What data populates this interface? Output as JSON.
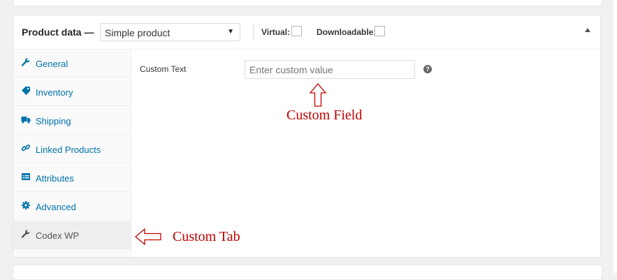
{
  "header": {
    "title": "Product data —",
    "product_type": "Simple product",
    "virtual_label": "Virtual:",
    "downloadable_label": "Downloadable:"
  },
  "sidebar": {
    "items": [
      {
        "label": "General",
        "icon": "wrench-icon"
      },
      {
        "label": "Inventory",
        "icon": "tag-icon"
      },
      {
        "label": "Shipping",
        "icon": "truck-icon"
      },
      {
        "label": "Linked Products",
        "icon": "link-icon"
      },
      {
        "label": "Attributes",
        "icon": "list-icon"
      },
      {
        "label": "Advanced",
        "icon": "gear-icon"
      },
      {
        "label": "Codex WP",
        "icon": "wrench-icon"
      }
    ],
    "active_index": 6
  },
  "main": {
    "field_label": "Custom Text",
    "field_placeholder": "Enter custom value",
    "field_value": "",
    "help_glyph": "?"
  },
  "annotations": {
    "field_note": "Custom Field",
    "tab_note": "Custom Tab",
    "color": "#c00000"
  },
  "colors": {
    "link": "#0073aa",
    "active_tab_bg": "#eeeeee",
    "annotation": "#c00000"
  }
}
